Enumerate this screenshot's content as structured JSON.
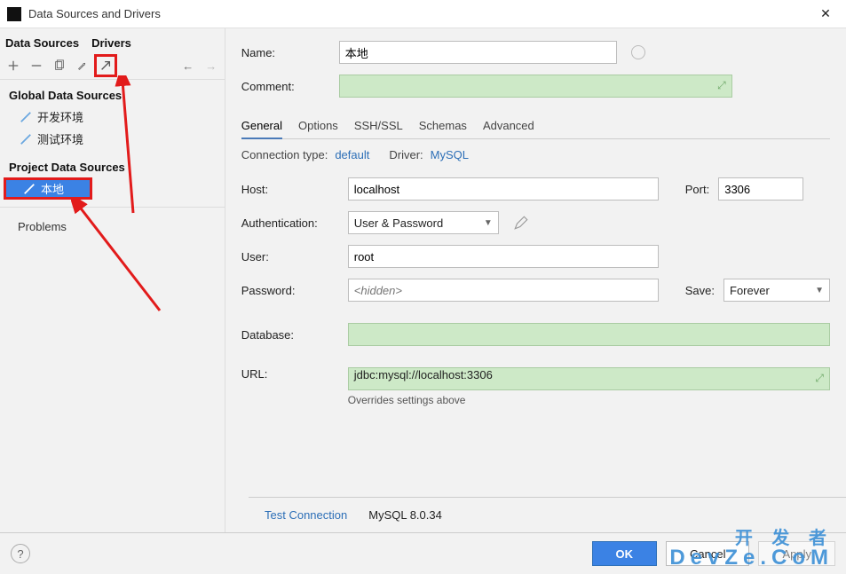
{
  "window": {
    "title": "Data Sources and Drivers"
  },
  "sidebar": {
    "tabs": [
      "Data Sources",
      "Drivers"
    ],
    "headings": {
      "global": "Global Data Sources",
      "project": "Project Data Sources",
      "problems": "Problems"
    },
    "global_items": [
      "开发环境",
      "测试环境"
    ],
    "project_items": [
      "本地"
    ]
  },
  "form": {
    "name_label": "Name:",
    "name_value": "本地",
    "comment_label": "Comment:",
    "tabs": [
      "General",
      "Options",
      "SSH/SSL",
      "Schemas",
      "Advanced"
    ],
    "connection": {
      "type_label": "Connection type:",
      "type_value": "default",
      "driver_label": "Driver:",
      "driver_value": "MySQL"
    },
    "host_label": "Host:",
    "host_value": "localhost",
    "port_label": "Port:",
    "port_value": "3306",
    "auth_label": "Authentication:",
    "auth_value": "User & Password",
    "user_label": "User:",
    "user_value": "root",
    "pwd_label": "Password:",
    "pwd_placeholder": "<hidden>",
    "save_label": "Save:",
    "save_value": "Forever",
    "db_label": "Database:",
    "url_label": "URL:",
    "url_value": "jdbc:mysql://localhost:3306",
    "url_hint": "Overrides settings above"
  },
  "bottom": {
    "test": "Test Connection",
    "driver_version": "MySQL 8.0.34"
  },
  "footer": {
    "ok": "OK",
    "cancel": "Cancel",
    "apply": "Apply"
  },
  "watermark": {
    "line1": "开 发 者",
    "line2": "DevZe.CoM"
  }
}
